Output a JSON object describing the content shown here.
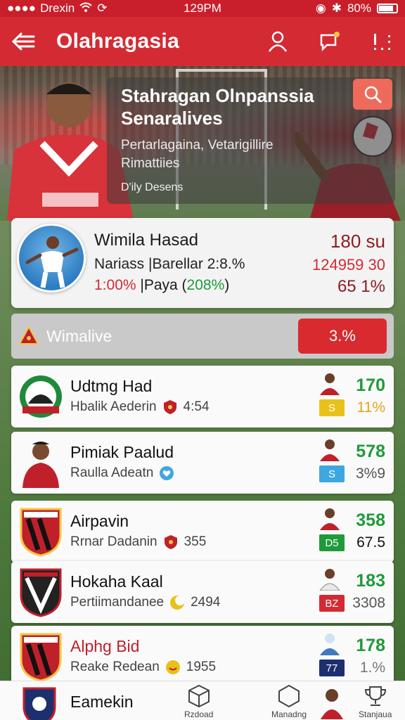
{
  "status": {
    "carrier": "Drexin",
    "time": "129PM",
    "battery": "80%"
  },
  "app_bar": {
    "title": "Olahragasia"
  },
  "hero": {
    "title_line1": "Stahragan Olnpanssia",
    "title_line2": "Senaralives",
    "subtitle_line1": "Pertarlagaina, Vetarigillire",
    "subtitle_line2": "Rimattiies",
    "tag": "D'ily Desens"
  },
  "profile": {
    "name": "Wimila Hasad",
    "line2": "Nariass |Barellar 2:8.%",
    "line3_prefix": "1:00%",
    "line3_mid": " |Paya (",
    "line3_green": "208%",
    "line3_suffix": ")",
    "value1": "180 su",
    "value2": "124959 30",
    "value3": "65 1%"
  },
  "section": {
    "label": "Wimalive",
    "pill": "3.%"
  },
  "list": [
    {
      "name": "Udtmg Had",
      "sub": "Hbalik Aederin",
      "sub_value": "4:54",
      "badge": "S",
      "badge_color": "#e8c21a",
      "value": "170",
      "pct": "11%",
      "pct_color": "#e8a21a",
      "name_color": "#111"
    },
    {
      "name": "Pimiak Paalud",
      "sub": "Raulla Adeatn",
      "sub_value": "",
      "badge": "S",
      "badge_color": "#3fa7e0",
      "value": "578",
      "pct": "3%9",
      "pct_color": "#555",
      "name_color": "#111"
    },
    {
      "name": "Airpavin",
      "sub": "Rrnar Dadanin",
      "sub_value": "355",
      "badge": "D5",
      "badge_color": "#1f9a3a",
      "value": "358",
      "pct": "67.5",
      "pct_color": "#111",
      "name_color": "#111"
    },
    {
      "name": "Hokaha Kaal",
      "sub": "Pertiimandanee",
      "sub_value": "2494",
      "badge": "BZ",
      "badge_color": "#d42a33",
      "value": "183",
      "pct": "3308",
      "pct_color": "#555",
      "name_color": "#111"
    },
    {
      "name": "Alphg Bid",
      "sub": "Reake Redean",
      "sub_value": "1955",
      "badge": "77",
      "badge_color": "#1c2f6e",
      "value": "178",
      "pct": "1.%",
      "pct_color": "#777",
      "name_color": "#c0202a"
    }
  ],
  "peek_item": {
    "name": "Eamekin"
  },
  "bottom_nav": {
    "items": [
      "Rzdoad",
      "Manadng",
      "Stanjaua"
    ]
  }
}
